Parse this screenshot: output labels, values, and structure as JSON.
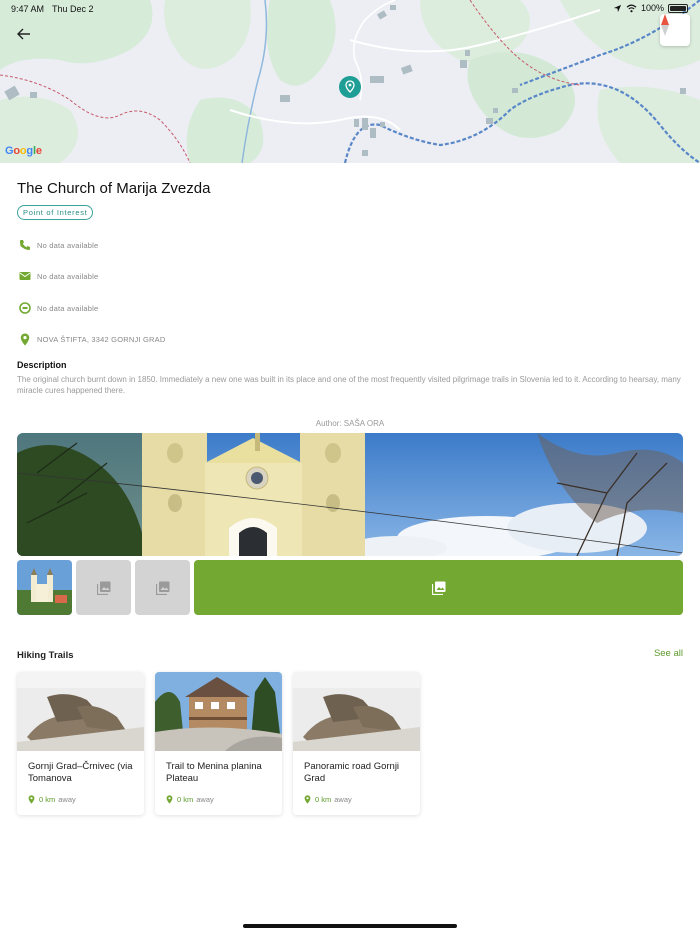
{
  "status_bar": {
    "time": "9:47 AM",
    "date": "Thu Dec 2",
    "battery": "100%"
  },
  "map": {
    "attribution": "Google"
  },
  "poi": {
    "title": "The Church of Marija Zvezda",
    "category": "Point of Interest",
    "phone": "No data available",
    "email": "No data available",
    "website": "No data available",
    "address": "NOVA ŠTIFTA, 3342 GORNJI GRAD"
  },
  "description": {
    "heading": "Description",
    "text": "The original church burnt down in 1850. Immediately a new one was built in its place and one of the most frequently visited pilgrimage trails in Slovenia led to it. According to hearsay, many miracle cures happened there."
  },
  "author": "Author: SAŠA ORA",
  "hiking": {
    "heading": "Hiking Trails",
    "see_all": "See all",
    "unit_label": "away",
    "trails": [
      {
        "name": "Gornji Grad–Črnivec (via Tomanova",
        "distance": "0 km"
      },
      {
        "name": "Trail to Menina planina Plateau",
        "distance": "0 km"
      },
      {
        "name": "Panoramic road Gornji Grad",
        "distance": "0 km"
      }
    ]
  },
  "colors": {
    "accent_green": "#73a832",
    "teal": "#2a9c95"
  }
}
